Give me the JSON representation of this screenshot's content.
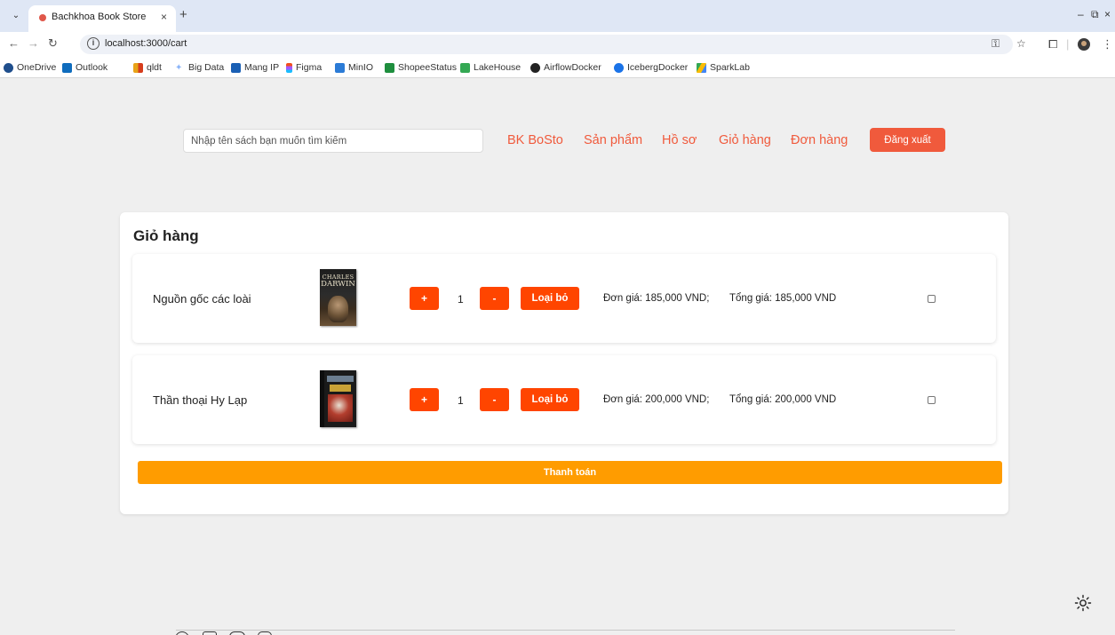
{
  "browser": {
    "tab_title": "Bachkhoa Book Store",
    "tab_close": "×",
    "new_tab": "+",
    "url": "localhost:3000/cart",
    "window_controls": [
      "–",
      "⧉",
      "×"
    ],
    "bookmarks": [
      {
        "label": "OneDrive",
        "icon": "cloud-icon",
        "color": "#1f4e8c"
      },
      {
        "label": "Outlook",
        "icon": "outlook-icon",
        "color": "#0f6cbd"
      },
      {
        "label": "qldt",
        "icon": "qldt-icon",
        "color": "#e8a318"
      },
      {
        "label": "Big Data",
        "icon": "star-bookmark-icon",
        "color": "#8ab4f8"
      },
      {
        "label": "Mang IP",
        "icon": "d-icon",
        "color": "#1a5fb4"
      },
      {
        "label": "Figma",
        "icon": "figma-icon",
        "color": "#f24e1e"
      },
      {
        "label": "MinIO",
        "icon": "tb-icon",
        "color": "#2b7bd6"
      },
      {
        "label": "ShopeeStatus",
        "icon": "sheet-icon",
        "color": "#1e8e3e"
      },
      {
        "label": "LakeHouse",
        "icon": "lake-icon",
        "color": "#34a853"
      },
      {
        "label": "AirflowDocker",
        "icon": "github-icon",
        "color": "#222222"
      },
      {
        "label": "IcebergDocker",
        "icon": "globe-icon",
        "color": "#1a73e8"
      },
      {
        "label": "SparkLab",
        "icon": "drive-icon",
        "color": "#fbbc04"
      }
    ]
  },
  "header": {
    "search_placeholder": "Nhập tên sách bạn muốn tìm kiếm",
    "nav": [
      "BK BoSto",
      "Sản phẩm",
      "Hồ sơ",
      "Giỏ hàng",
      "Đơn hàng"
    ],
    "logout": "Đăng xuất"
  },
  "cart": {
    "title": "Giỏ hàng",
    "plus": "+",
    "minus": "-",
    "remove": "Loại bỏ",
    "items": [
      {
        "name": "Nguồn gốc các loài",
        "cover_line1": "CHARLES",
        "cover_line2": "DARWIN",
        "quantity": "1",
        "unit_price": "Đơn giá: 185,000 VND;",
        "total": "Tổng giá: 185,000 VND"
      },
      {
        "name": "Thần thoại Hy Lạp",
        "quantity": "1",
        "unit_price": "Đơn giá: 200,000 VND;",
        "total": "Tổng giá: 200,000 VND"
      }
    ],
    "checkout": "Thanh toán"
  },
  "colors": {
    "accent": "#f05a3c",
    "button": "#ff4500",
    "checkout": "#ff9c00"
  }
}
